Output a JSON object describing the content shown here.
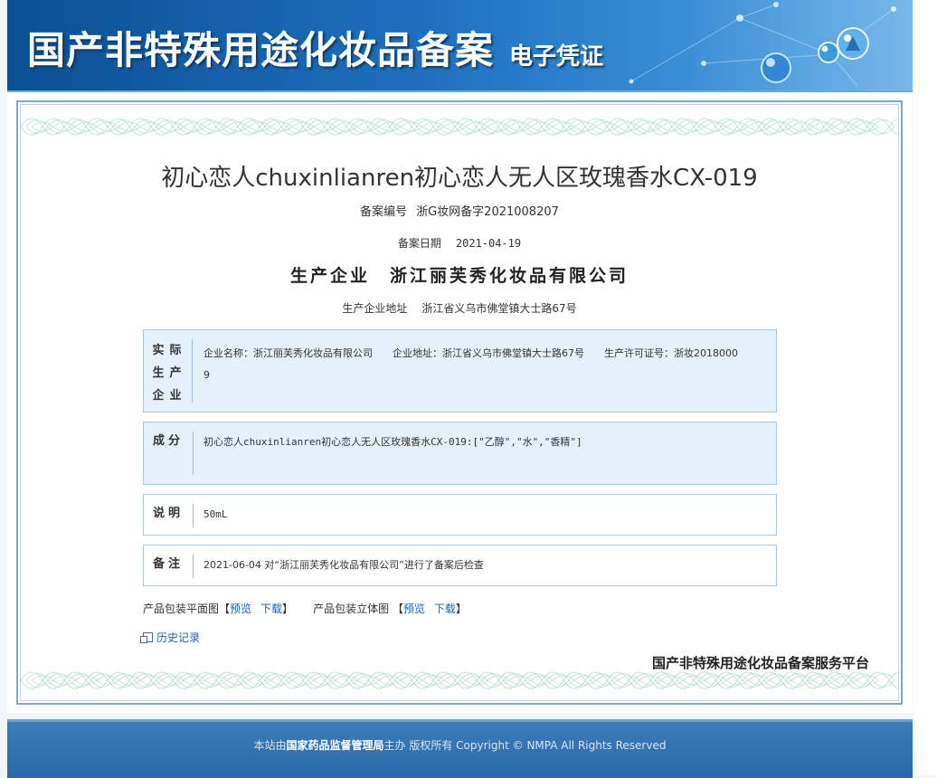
{
  "header": {
    "title": "国产非特殊用途化妆品备案",
    "subtitle": "电子凭证"
  },
  "certificate": {
    "product_name": "初心恋人chuxinlianren初心恋人无人区玫瑰香水CX-019",
    "registration_label": "备案编号",
    "registration_number": "浙G妆网备字2021008207",
    "date_label": "备案日期",
    "date_value": "2021-04-19",
    "maker_label": "生产企业",
    "maker_name": "浙江丽芙秀化妆品有限公司",
    "address_label": "生产企业地址",
    "address_value": "浙江省义乌市佛堂镇大士路67号",
    "sections": {
      "actual_producer": {
        "label": "实际生产企业",
        "company": "企业名称：浙江丽芙秀化妆品有限公司",
        "address": "企业地址：浙江省义乌市佛堂镇大士路67号",
        "license": "生产许可证号：浙妆20180009"
      },
      "ingredients": {
        "label": "成分",
        "text": "初心恋人chuxinlianren初心恋人无人区玫瑰香水CX-019:[\"乙醇\",\"水\",\"香精\"]"
      },
      "description": {
        "label": "说明",
        "text": "50mL"
      },
      "remarks": {
        "label": "备注",
        "text": "2021-06-04 对“浙江丽芙秀化妆品有限公司”进行了备案后检查"
      }
    },
    "packaging": {
      "flat_label": "产品包装平面图【",
      "solid_label": "产品包装立体图 【",
      "preview": "预览",
      "download": "下载",
      "close_bracket": "】"
    },
    "history_label": "历史记录",
    "platform_name": "国产非特殊用途化妆品备案服务平台"
  },
  "footer": {
    "prefix": "本站由",
    "agency": "国家药品监督管理局",
    "suffix": "主办 版权所有 Copyright © NMPA All Rights Reserved"
  },
  "colors": {
    "banner_dark": "#0b4f93",
    "banner_light": "#79b8ea",
    "box_shade": "#e4f1fb",
    "link": "#1f5fa8",
    "footer_bg": "#2a69a9"
  }
}
